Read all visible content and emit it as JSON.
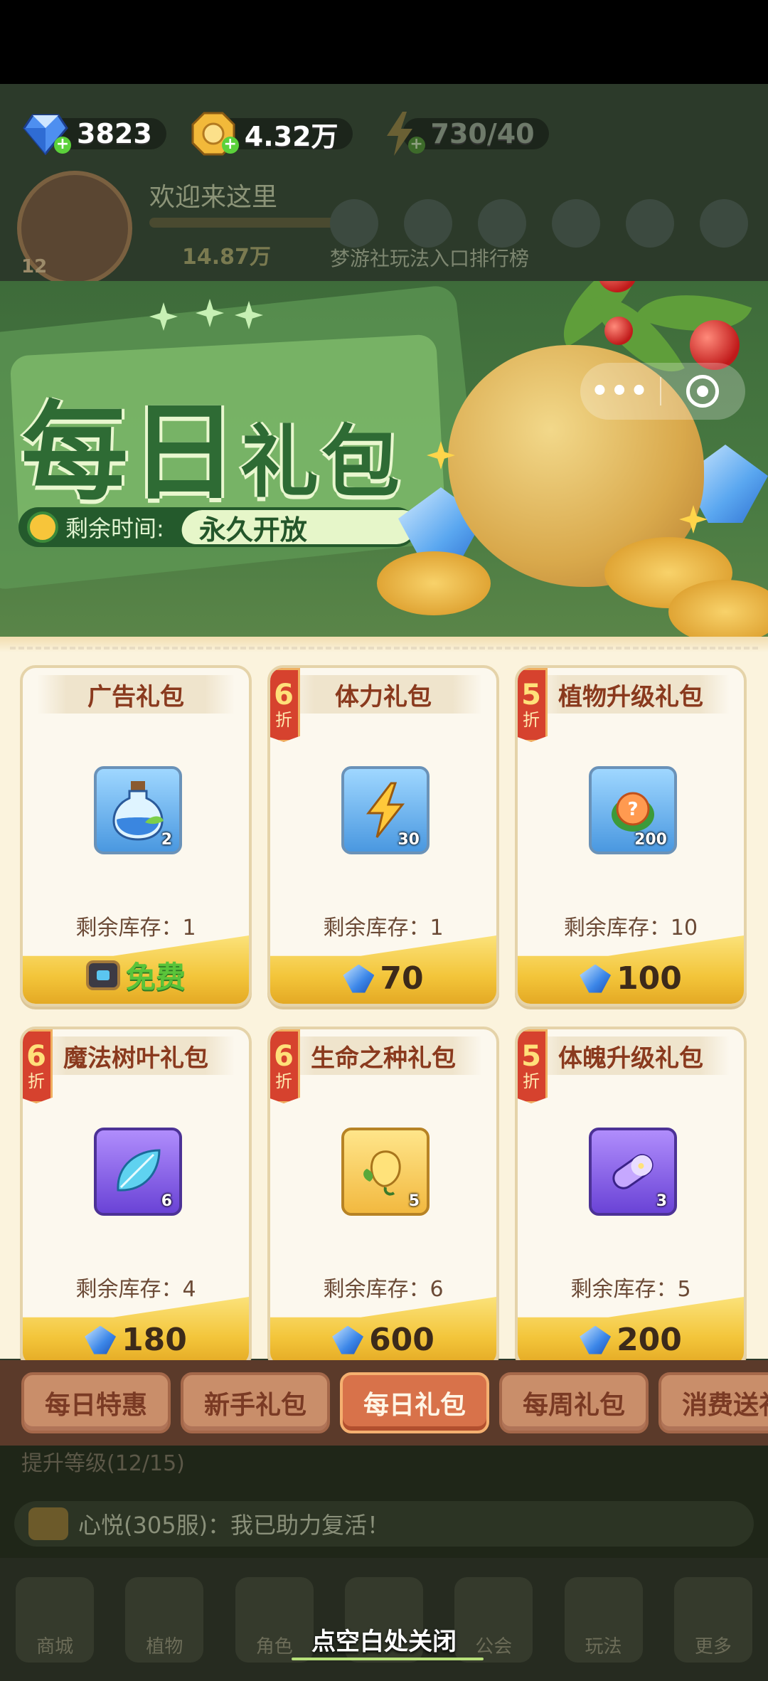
{
  "resources": {
    "gems": "3823",
    "coins": "4.32万",
    "stamina": "730/40"
  },
  "player": {
    "level": "12",
    "welcome": "欢迎来这里",
    "power": "14.87万",
    "menu_text": "梦游社玩法入口排行榜"
  },
  "banner": {
    "title_a": "每日",
    "title_b": "礼包",
    "timer_label": "剩余时间:",
    "timer_value": "永久开放"
  },
  "capsule": {
    "more_label": "•••"
  },
  "cards": [
    {
      "title": "广告礼包",
      "discount": "",
      "qty": "2",
      "stock": "剩余库存：1",
      "price": "免费",
      "price_type": "free",
      "icon": "potion-icon"
    },
    {
      "title": "体力礼包",
      "discount": "6",
      "qty": "30",
      "stock": "剩余库存：1",
      "price": "70",
      "price_type": "gem",
      "icon": "lightning-icon"
    },
    {
      "title": "植物升级礼包",
      "discount": "5",
      "qty": "200",
      "stock": "剩余库存：10",
      "price": "100",
      "price_type": "gem",
      "icon": "mystery-seed-icon"
    },
    {
      "title": "魔法树叶礼包",
      "discount": "6",
      "qty": "6",
      "stock": "剩余库存：4",
      "price": "180",
      "price_type": "gem",
      "icon": "magic-leaf-icon"
    },
    {
      "title": "生命之种礼包",
      "discount": "6",
      "qty": "5",
      "stock": "剩余库存：6",
      "price": "600",
      "price_type": "gem",
      "icon": "life-seed-icon"
    },
    {
      "title": "体魄升级礼包",
      "discount": "5",
      "qty": "3",
      "stock": "剩余库存：5",
      "price": "200",
      "price_type": "gem",
      "icon": "capsule-icon"
    }
  ],
  "discount_suffix": "折",
  "tabs": [
    {
      "label": "每日特惠",
      "active": false
    },
    {
      "label": "新手礼包",
      "active": false
    },
    {
      "label": "每日礼包",
      "active": true
    },
    {
      "label": "每周礼包",
      "active": false
    },
    {
      "label": "消费送礼",
      "active": false
    }
  ],
  "footer": {
    "level_task": "提升等级(12/15)",
    "chat": "心悦(305服)：我已助力复活！",
    "nav": [
      "商城",
      "植物",
      "角色",
      "",
      "公会",
      "玩法",
      "更多"
    ],
    "close_hint": "点空白处关闭"
  },
  "colors": {
    "accent": "#d8724a",
    "panel": "#fbf3dd",
    "title_text": "#8a3a1e",
    "free_green": "#5ac43a"
  }
}
